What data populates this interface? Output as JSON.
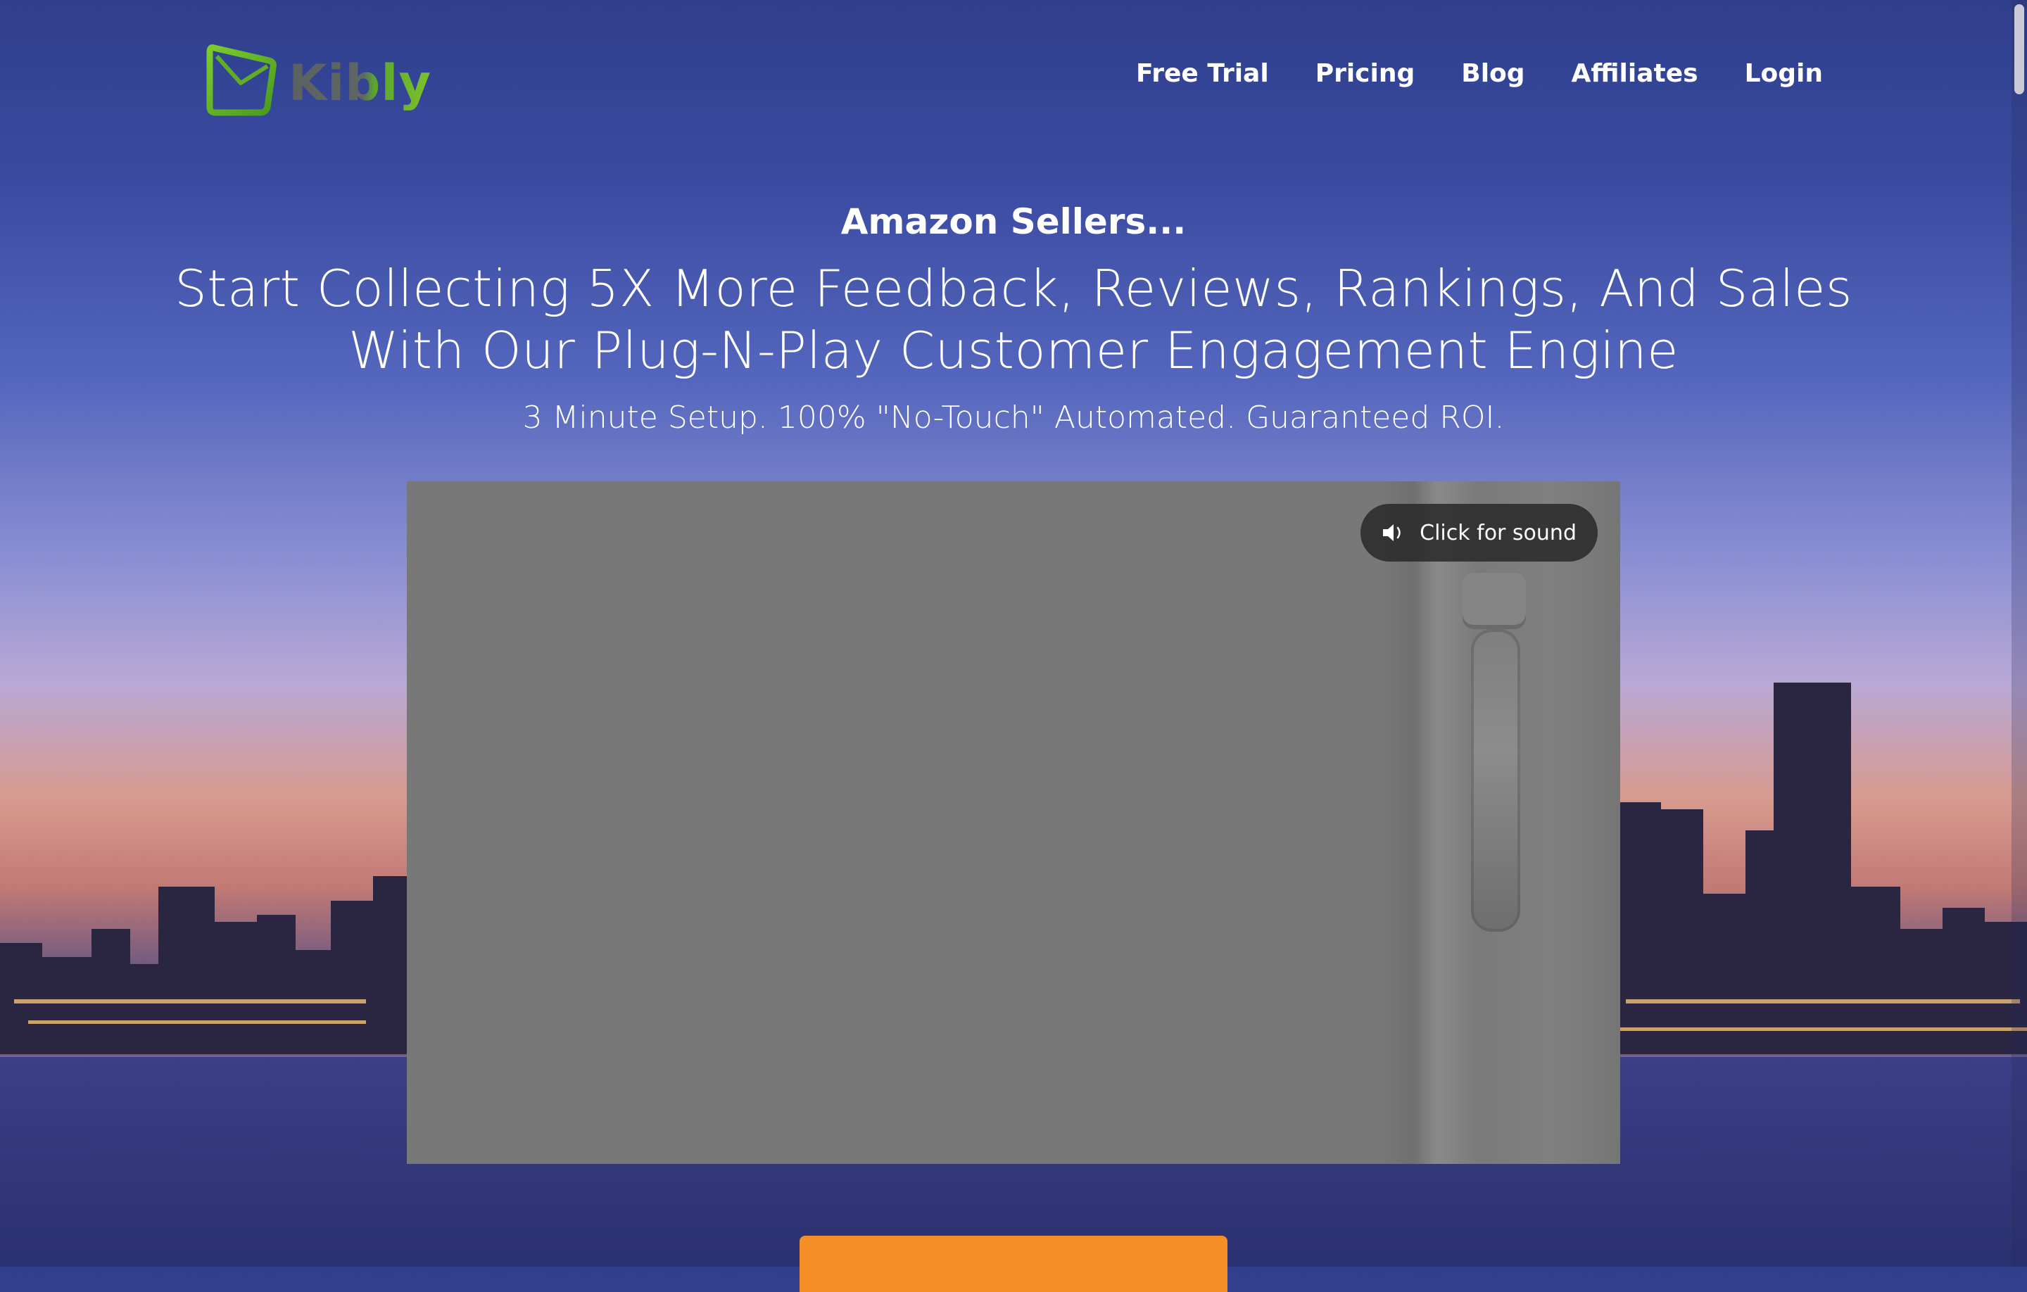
{
  "brand": {
    "name": "Kibly",
    "logo_icon": "envelope-icon",
    "accent": "#6bb82a"
  },
  "nav": {
    "items": [
      {
        "label": "Free Trial"
      },
      {
        "label": "Pricing"
      },
      {
        "label": "Blog"
      },
      {
        "label": "Affiliates"
      },
      {
        "label": "Login"
      }
    ]
  },
  "hero": {
    "pretitle": "Amazon Sellers...",
    "headline_line1": "Start Collecting 5X More Feedback, Reviews, Rankings, And Sales",
    "headline_line2": "With Our Plug-N-Play Customer Engagement Engine",
    "subtitle": "3 Minute Setup. 100% \"No-Touch\" Automated. Guaranteed ROI."
  },
  "video": {
    "sound_button_label": "Click for sound",
    "sound_icon": "speaker-icon"
  },
  "cta": {
    "color": "#f68e27"
  }
}
